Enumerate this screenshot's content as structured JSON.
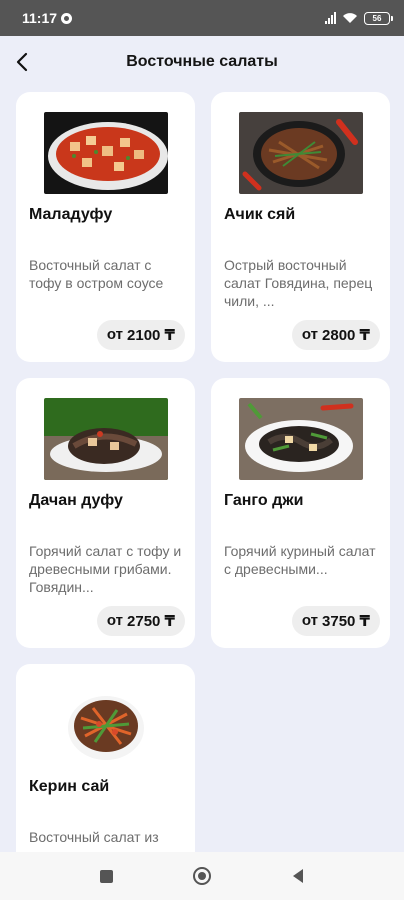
{
  "status_bar": {
    "time": "11:17",
    "battery": "56"
  },
  "header": {
    "title": "Восточные салаты"
  },
  "products": [
    {
      "name": "Маладуфу",
      "description": "Восточный салат с тофу в остром соусе",
      "price_prefix": "от",
      "price": "2100 ₸",
      "icon": "mapo-tofu-photo"
    },
    {
      "name": "Ачик сяй",
      "description": "Острый восточный салат Говядина, перец чили, ...",
      "price_prefix": "от",
      "price": "2800 ₸",
      "icon": "beef-chili-photo"
    },
    {
      "name": "Дачан дуфу",
      "description": "Горячий салат с тофу и древесными грибами. Говядин...",
      "price_prefix": "от",
      "price": "2750 ₸",
      "icon": "tofu-mushroom-photo"
    },
    {
      "name": "Ганго джи",
      "description": "Горячий куриный салат с древесными...",
      "price_prefix": "от",
      "price": "3750 ₸",
      "icon": "chicken-mushroom-photo"
    },
    {
      "name": "Керин сай",
      "description": "Восточный салат из",
      "price_prefix": "",
      "price": "",
      "icon": "vegetable-salad-photo"
    }
  ],
  "colors": {
    "background": "#eceef8",
    "card": "#ffffff",
    "price_badge": "#eeeeee",
    "status_bar": "#555555"
  }
}
